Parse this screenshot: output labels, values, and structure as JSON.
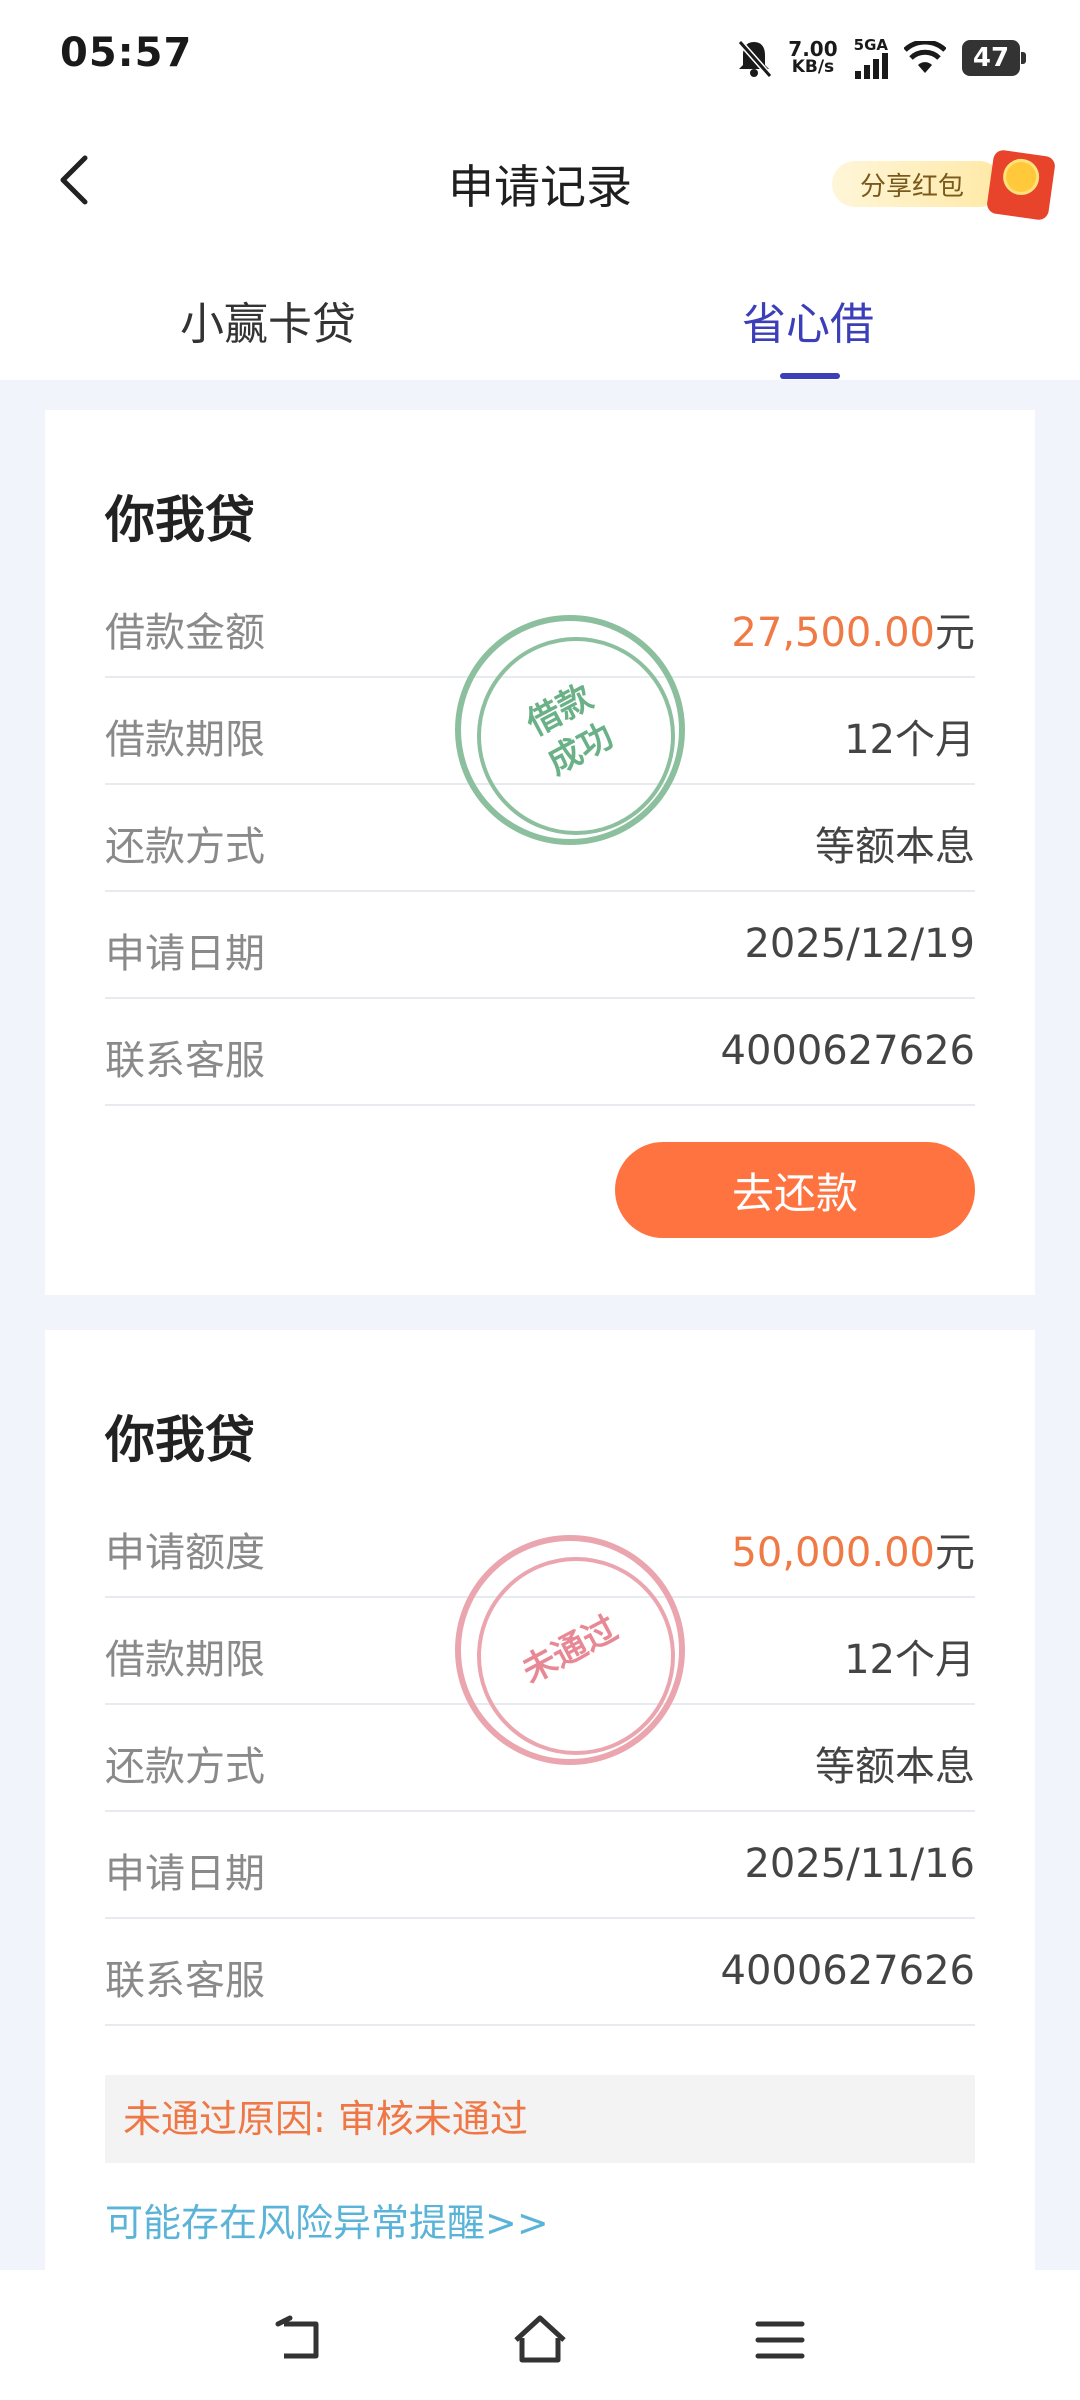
{
  "status": {
    "time": "05:57",
    "speed_value": "7.00",
    "speed_unit": "KB/s",
    "network": "5GA",
    "battery": "47",
    "icons": [
      "mute-bell-icon",
      "signal-icon",
      "wifi-icon",
      "battery-icon"
    ]
  },
  "header": {
    "title": "申请记录",
    "share_label": "分享红包"
  },
  "tabs": [
    {
      "label": "小赢卡贷",
      "active": false
    },
    {
      "label": "省心借",
      "active": true
    }
  ],
  "cards": [
    {
      "title": "你我贷",
      "stamp": "借款成功",
      "stamp_line1": "借款",
      "stamp_line2": "成功",
      "rows": [
        {
          "label": "借款金额",
          "value": "27,500.00",
          "unit": "元"
        },
        {
          "label": "借款期限",
          "value": "12个月"
        },
        {
          "label": "还款方式",
          "value": "等额本息"
        },
        {
          "label": "申请日期",
          "value": "2025/12/19"
        },
        {
          "label": "联系客服",
          "value": "4000627626"
        }
      ],
      "button": "去还款"
    },
    {
      "title": "你我贷",
      "stamp": "未通过",
      "rows": [
        {
          "label": "申请额度",
          "value": "50,000.00",
          "unit": "元"
        },
        {
          "label": "借款期限",
          "value": "12个月"
        },
        {
          "label": "还款方式",
          "value": "等额本息"
        },
        {
          "label": "申请日期",
          "value": "2025/11/16"
        },
        {
          "label": "联系客服",
          "value": "4000627626"
        }
      ],
      "reason": "未通过原因: 审核未通过",
      "link": "可能存在风险异常提醒>>"
    }
  ],
  "colors": {
    "accent": "#3c3fb8",
    "money": "#f07a46",
    "button": "#ff7340",
    "link": "#5bb4d8"
  }
}
